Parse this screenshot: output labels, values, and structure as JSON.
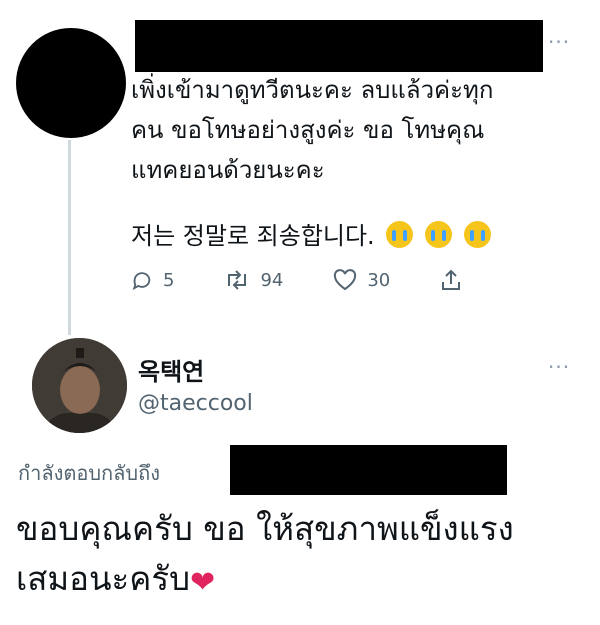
{
  "tweet1": {
    "menu": "···",
    "text_lines": [
      "เพิ่งเข้ามาดูทวีตนะคะ ลบแล้วค่ะทุก",
      "คน ขอโทษอย่างสูงค่ะ ขอ โทษคุณ",
      "แทคยอนด้วยนะคะ"
    ],
    "korean_line": "저는 정말로 죄송합니다.",
    "emoji": [
      "crying-face",
      "crying-face",
      "crying-face"
    ],
    "actions": {
      "replies": "5",
      "retweets": "94",
      "likes": "30"
    }
  },
  "tweet2": {
    "display_name": "옥택연",
    "handle": "@taeccool",
    "menu": "···",
    "reply_label": "กำลังตอบกลับถึง",
    "text_lines": [
      "ขอบคุณครับ ขอ ให้สุขภาพแข็งแรง",
      "เสมอนะครับ"
    ],
    "heart_emoji": "❤"
  }
}
